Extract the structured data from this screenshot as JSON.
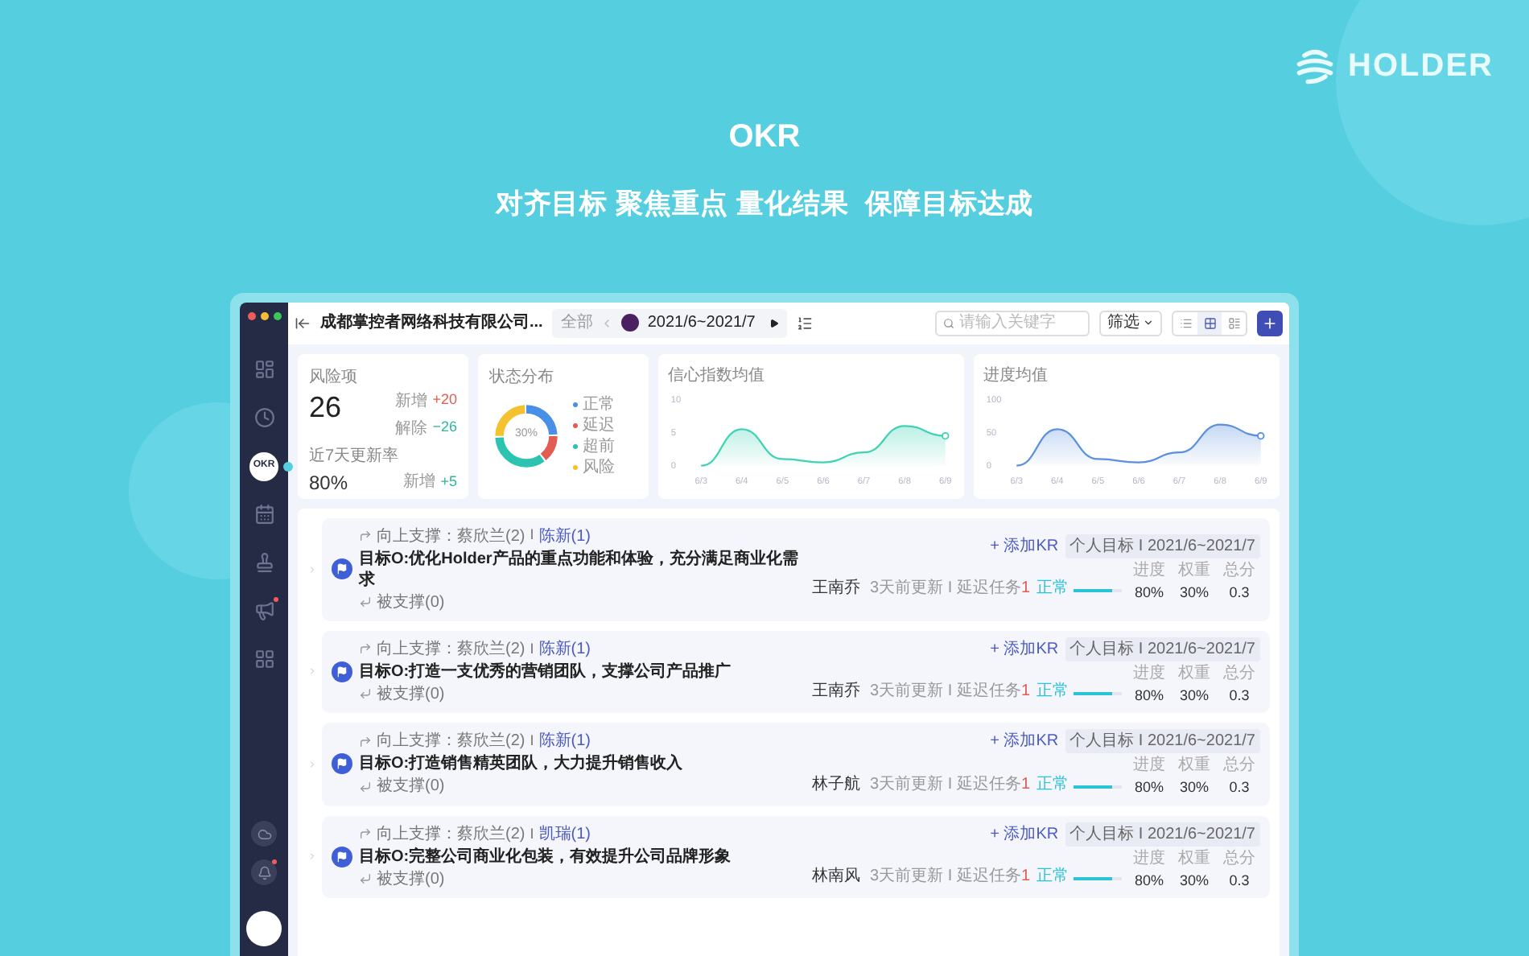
{
  "brand": {
    "name": "HOLDER"
  },
  "hero": {
    "title": "OKR",
    "subtitle": "对齐目标 聚焦重点 量化结果  保障目标达成"
  },
  "sidebar": {
    "items": [
      {
        "kind": "icon",
        "selected": false,
        "badge": false
      },
      {
        "kind": "icon",
        "selected": false,
        "badge": false
      },
      {
        "kind": "label",
        "label": "OKR",
        "selected": true,
        "badge": false
      },
      {
        "kind": "icon",
        "selected": false,
        "badge": false
      },
      {
        "kind": "icon",
        "selected": false,
        "badge": false
      },
      {
        "kind": "icon",
        "selected": false,
        "badge": true
      },
      {
        "kind": "icon",
        "selected": false,
        "badge": false
      }
    ],
    "bottom": [
      {
        "badge": false
      },
      {
        "badge": true
      }
    ]
  },
  "toolbar": {
    "company": "成都掌控者网络科技有限公司...",
    "filter_all": "全部",
    "period": "2021/6~2021/7",
    "search": {
      "placeholder": "请输入关键字"
    },
    "filter": "筛选",
    "views": [
      {
        "selected": false
      },
      {
        "selected": true
      },
      {
        "selected": false
      }
    ]
  },
  "stats": {
    "title": "风险项",
    "value": "26",
    "added_label": "新增",
    "added": "+20",
    "removed_label": "解除",
    "removed": "−26",
    "rate_title": "近7天更新率",
    "rate": "80%",
    "rate_added_label": "新增",
    "rate_added": "+5"
  },
  "status_card": {
    "title": "状态分布",
    "center": "30%",
    "legend": [
      {
        "label": "正常",
        "color": "#4a8fe7"
      },
      {
        "label": "延迟",
        "color": "#e25c52"
      },
      {
        "label": "超前",
        "color": "#2cc3b0"
      },
      {
        "label": "风险",
        "color": "#f5c12e"
      }
    ]
  },
  "confidence_card": {
    "chart_data": {
      "type": "area",
      "title": "信心指数均值",
      "categories": [
        "6/3",
        "6/4",
        "6/5",
        "6/6",
        "6/7",
        "6/8",
        "6/9"
      ],
      "series": [
        {
          "color": "#3fd3b3",
          "values": [
            0,
            5.5,
            1,
            0.5,
            2,
            6,
            4.5
          ]
        }
      ],
      "ylim": [
        0,
        10
      ],
      "yticks": [
        0,
        5,
        10
      ]
    }
  },
  "progress_card": {
    "chart_data": {
      "type": "area",
      "title": "进度均值",
      "categories": [
        "6/3",
        "6/4",
        "6/5",
        "6/6",
        "6/7",
        "6/8",
        "6/9"
      ],
      "series": [
        {
          "color": "#5b8fe0",
          "values": [
            0,
            55,
            10,
            5,
            20,
            62,
            45
          ]
        }
      ],
      "ylim": [
        0,
        100
      ],
      "yticks": [
        0,
        50,
        100
      ]
    }
  },
  "objectives": [
    {
      "up_label": "向上支撑：蔡欣兰(2)",
      "sep": "I",
      "up_link": "陈新(1)",
      "title": "目标O:优化Holder产品的重点功能和体验，充分满足商业化需求",
      "down": "被支撑(0)",
      "owner": "王南乔",
      "updated": "3天前更新 I 延迟任务",
      "delayed": "1",
      "status": "正常",
      "level": 0.8,
      "add_kr": "+ 添加KR",
      "tag": "个人目标 I 2021/6~2021/7",
      "col_1": "进度",
      "col_2": "权重",
      "col_3": "总分",
      "progress": "80%",
      "weight": "30%",
      "score": "0.3"
    },
    {
      "up_label": "向上支撑：蔡欣兰(2)",
      "sep": "I",
      "up_link": "陈新(1)",
      "title": "目标O:打造一支优秀的营销团队，支撑公司产品推广",
      "down": "被支撑(0)",
      "owner": "王南乔",
      "updated": "3天前更新 I 延迟任务",
      "delayed": "1",
      "status": "正常",
      "level": 0.8,
      "add_kr": "+ 添加KR",
      "tag": "个人目标 I 2021/6~2021/7",
      "col_1": "进度",
      "col_2": "权重",
      "col_3": "总分",
      "progress": "80%",
      "weight": "30%",
      "score": "0.3"
    },
    {
      "up_label": "向上支撑：蔡欣兰(2)",
      "sep": "I",
      "up_link": "陈新(1)",
      "title": "目标O:打造销售精英团队，大力提升销售收入",
      "down": "被支撑(0)",
      "owner": "林子航",
      "updated": "3天前更新 I 延迟任务",
      "delayed": "1",
      "status": "正常",
      "level": 0.8,
      "add_kr": "+ 添加KR",
      "tag": "个人目标 I 2021/6~2021/7",
      "col_1": "进度",
      "col_2": "权重",
      "col_3": "总分",
      "progress": "80%",
      "weight": "30%",
      "score": "0.3"
    },
    {
      "up_label": "向上支撑：蔡欣兰(2)",
      "sep": "I",
      "up_link": "凯瑞(1)",
      "title": "目标O:完整公司商业化包装，有效提升公司品牌形象",
      "down": "被支撑(0)",
      "owner": "林南风",
      "updated": "3天前更新 I 延迟任务",
      "delayed": "1",
      "status": "正常",
      "level": 0.8,
      "add_kr": "+ 添加KR",
      "tag": "个人目标 I 2021/6~2021/7",
      "col_1": "进度",
      "col_2": "权重",
      "col_3": "总分",
      "progress": "80%",
      "weight": "30%",
      "score": "0.3"
    }
  ]
}
